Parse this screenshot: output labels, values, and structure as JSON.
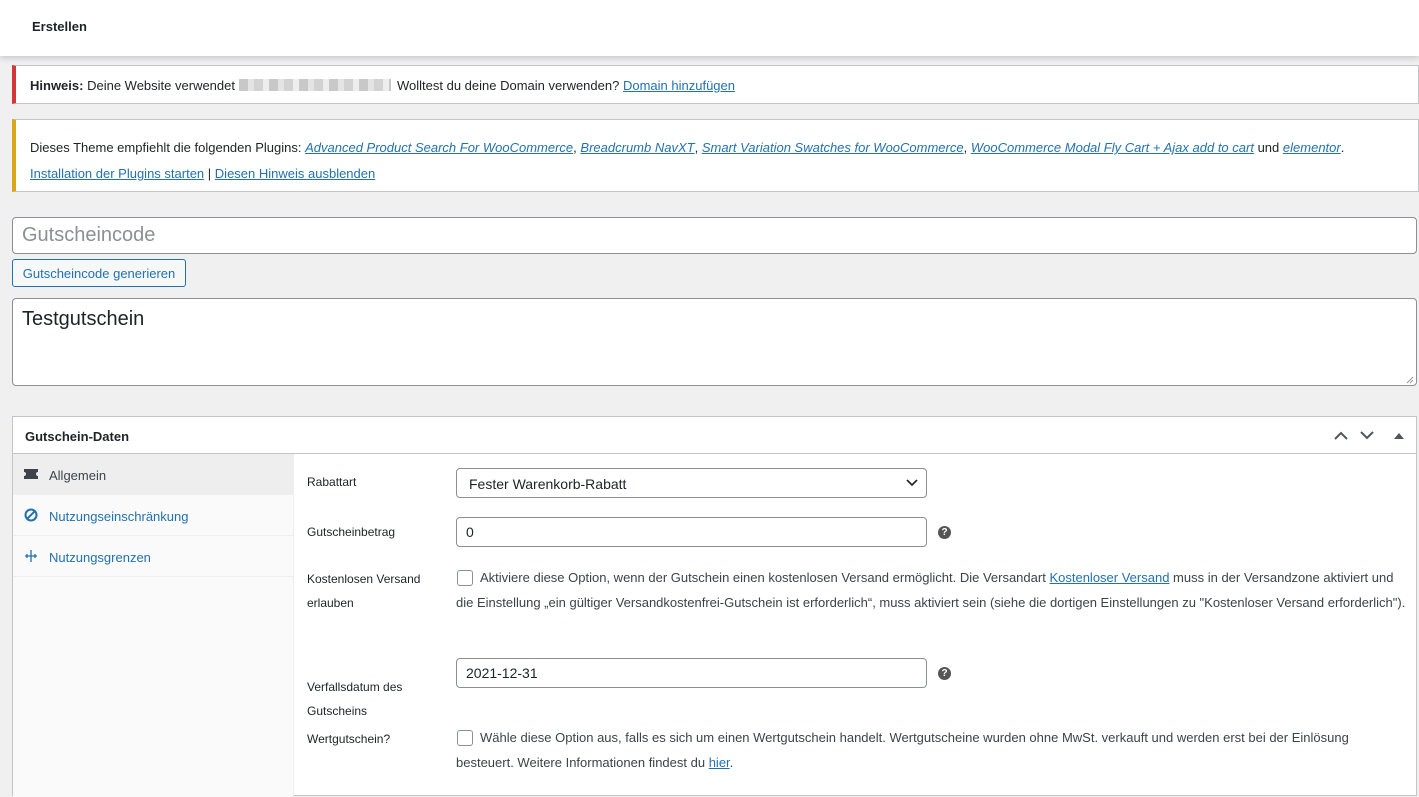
{
  "header": {
    "title": "Erstellen"
  },
  "notice_domain": {
    "label": "Hinweis:",
    "text_before": "Deine Website verwendet",
    "text_after": "Wolltest du deine Domain verwenden?",
    "link": "Domain hinzufügen",
    "accent_color": "#d63638"
  },
  "notice_plugins": {
    "text_before": "Dieses Theme empfiehlt die folgenden Plugins:",
    "plugins": [
      "Advanced Product Search For WooCommerce",
      "Breadcrumb NavXT",
      "Smart Variation Swatches for WooCommerce",
      "WooCommerce Modal Fly Cart + Ajax add to cart",
      "elementor"
    ],
    "sep": ",",
    "and": "und",
    "end": ".",
    "install_link": "Installation der Plugins starten",
    "divider": "|",
    "dismiss_link": "Diesen Hinweis ausblenden",
    "accent_color": "#dba617"
  },
  "coupon": {
    "code_placeholder": "Gutscheincode",
    "generate_button": "Gutscheincode generieren",
    "description": "Testgutschein"
  },
  "coupon_data": {
    "title": "Gutschein-Daten",
    "tabs": [
      {
        "label": "Allgemein",
        "icon": "ticket-icon",
        "active": true
      },
      {
        "label": "Nutzungseinschränkung",
        "icon": "ban-icon",
        "active": false
      },
      {
        "label": "Nutzungsgrenzen",
        "icon": "limits-icon",
        "active": false
      }
    ],
    "fields": {
      "discount_type": {
        "label": "Rabattart",
        "value": "Fester Warenkorb-Rabatt"
      },
      "amount": {
        "label": "Gutscheinbetrag",
        "value": "0"
      },
      "free_shipping": {
        "label": "Kostenlosen Versand erlauben",
        "checked": false,
        "text_before": "Aktiviere diese Option, wenn der Gutschein einen kostenlosen Versand ermöglicht. Die Versandart",
        "link": "Kostenloser Versand",
        "text_after": "muss in der Versandzone aktiviert und die Einstellung „ein gültiger Versandkostenfrei-Gutschein ist erforderlich“, muss aktiviert sein (siehe die dortigen Einstellungen zu \"Kostenloser Versand erforderlich\")."
      },
      "expiry_date": {
        "label": "Verfallsdatum des Gutscheins",
        "value": "2021-12-31"
      },
      "voucher": {
        "label": "Wertgutschein?",
        "checked": false,
        "text_before": "Wähle diese Option aus, falls es sich um einen Wertgutschein handelt. Wertgutscheine wurden ohne MwSt. verkauft und werden erst bei der Einlösung besteuert. Weitere Informationen findest du",
        "link": "hier",
        "end": "."
      }
    }
  }
}
